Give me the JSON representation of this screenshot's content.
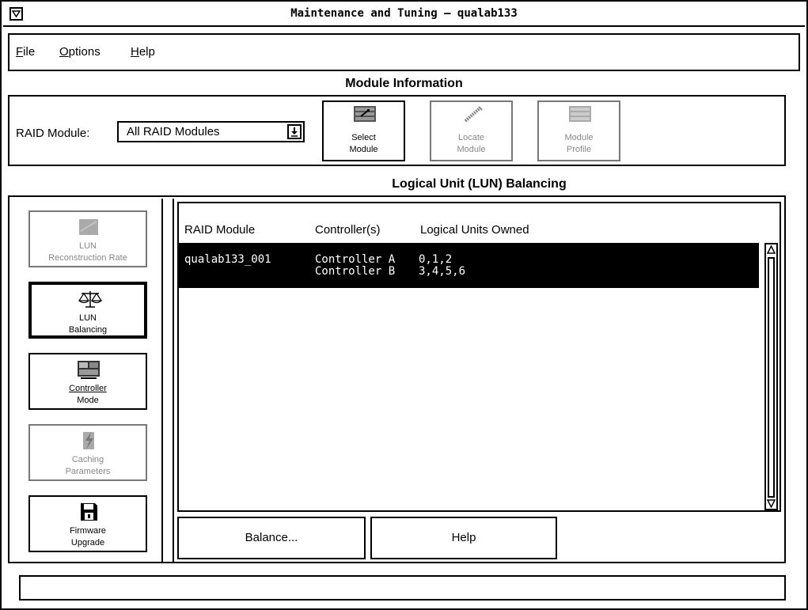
{
  "window": {
    "title": "Maintenance and Tuning – qualab133"
  },
  "menu": {
    "items": [
      {
        "mnemonic": "F",
        "rest": "ile"
      },
      {
        "mnemonic": "O",
        "rest": "ptions"
      },
      {
        "mnemonic": "H",
        "rest": "elp"
      }
    ]
  },
  "module_info": {
    "section_title": "Module Information",
    "raid_label": "RAID Module:",
    "raid_value": "All RAID Modules",
    "buttons": [
      {
        "line1": "Select",
        "line2": "Module",
        "enabled": true,
        "icon": "select-module-icon"
      },
      {
        "line1": "Locate",
        "line2": "Module",
        "enabled": false,
        "icon": "locate-module-icon"
      },
      {
        "line1": "Module",
        "line2": "Profile",
        "enabled": false,
        "icon": "module-profile-icon"
      }
    ]
  },
  "lun_balancing": {
    "section_title": "Logical Unit (LUN) Balancing",
    "side_buttons": [
      {
        "line1": "LUN",
        "line2": "Reconstruction Rate",
        "enabled": false,
        "active": false,
        "icon": "lun-reconstruction-icon"
      },
      {
        "line1": "LUN",
        "line2": "Balancing",
        "enabled": true,
        "active": true,
        "icon": "balance-scale-icon"
      },
      {
        "line1": "Controller",
        "line2": "Mode",
        "enabled": true,
        "active": false,
        "icon": "controller-mode-icon"
      },
      {
        "line1": "Caching",
        "line2": "Parameters",
        "enabled": false,
        "active": false,
        "icon": "caching-lightning-icon"
      },
      {
        "line1": "Firmware",
        "line2": "Upgrade",
        "enabled": true,
        "active": false,
        "icon": "floppy-disk-icon"
      }
    ],
    "columns": [
      "RAID Module",
      "Controller(s)",
      "Logical Units Owned"
    ],
    "rows": [
      {
        "module": "qualab133_001",
        "controllers": [
          "Controller A",
          "Controller B"
        ],
        "luns": [
          "0,1,2",
          "3,4,5,6"
        ],
        "selected": true
      }
    ],
    "actions": {
      "balance_label": "Balance...",
      "help_label": "Help"
    }
  },
  "status": {
    "text": ""
  },
  "colors": {
    "background": "#ffffff",
    "border": "#000000",
    "selected_row": "#000000",
    "disabled_text": "#888888"
  }
}
